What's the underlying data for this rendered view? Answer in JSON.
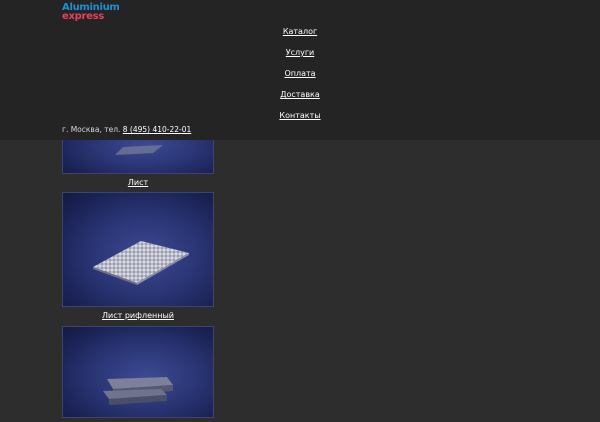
{
  "logo": {
    "line1": "Aluminium",
    "line2": "express"
  },
  "nav": [
    {
      "label": "Каталог"
    },
    {
      "label": "Услуги"
    },
    {
      "label": "Оплата"
    },
    {
      "label": "Доставка"
    },
    {
      "label": "Контакты"
    }
  ],
  "contact": {
    "prefix": "г. Москва, тел.",
    "phone": "8 (495) 410-22-01"
  },
  "products": [
    {
      "caption": "Лист"
    },
    {
      "caption": "Лист рифленный"
    },
    {
      "caption": ""
    }
  ],
  "colors": {
    "page_bg": "#2d2d2d",
    "header_bg": "#242424",
    "logo_blue": "#1e8fd6",
    "logo_red": "#e8415a",
    "image_bg": "#2a3575"
  }
}
